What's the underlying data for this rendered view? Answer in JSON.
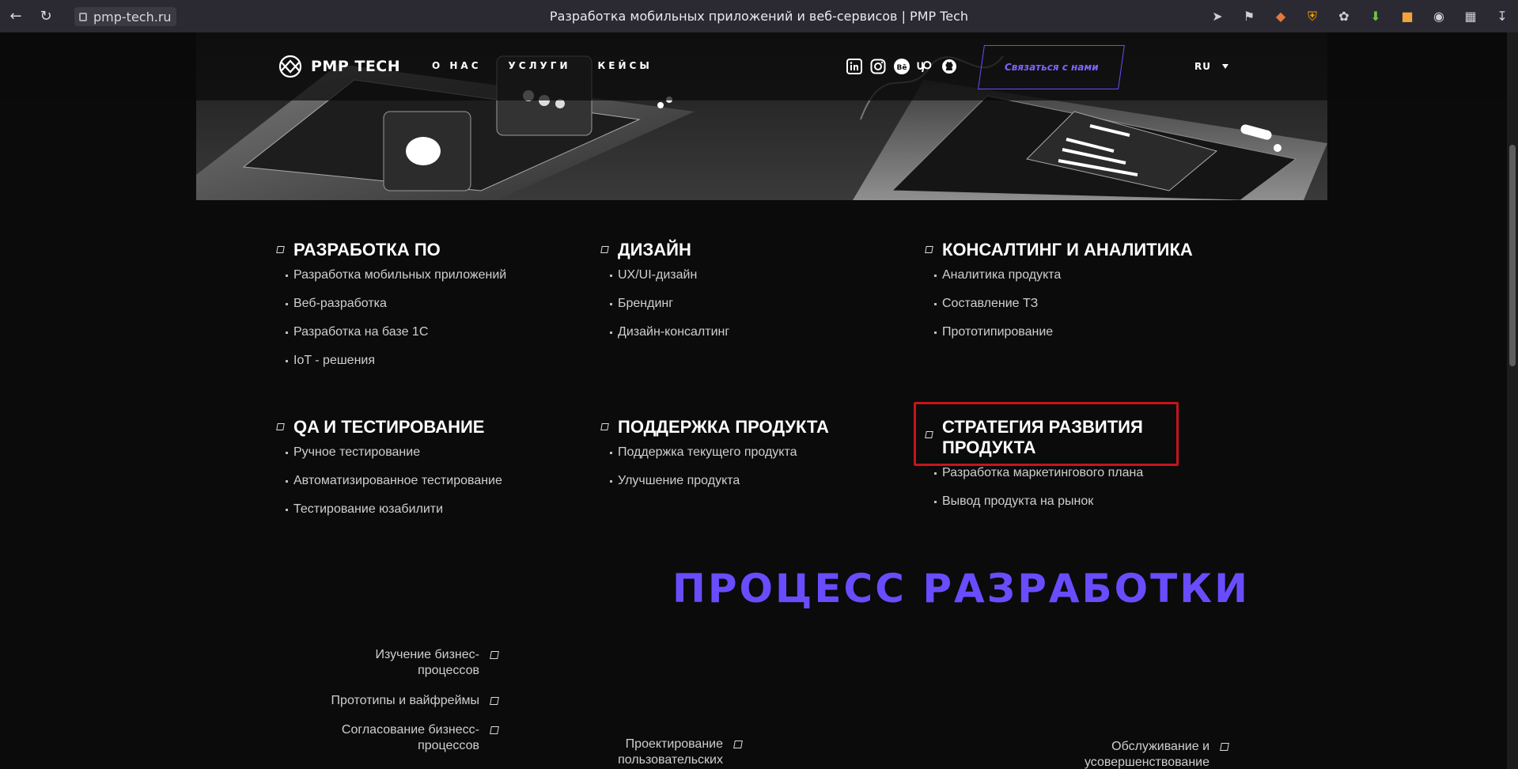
{
  "browser": {
    "url": "pmp-tech.ru",
    "tab_title": "Разработка мобильных приложений и веб-сервисов | PMP Tech"
  },
  "header": {
    "logo_text": "PMP TECH",
    "menu": [
      "О НАС",
      "УСЛУГИ",
      "КЕЙСЫ"
    ],
    "socials": [
      "linkedin-icon",
      "instagram-icon",
      "behance-icon",
      "upwork-icon",
      "github-icon"
    ],
    "contact_label": "Связаться с нами",
    "language": "RU",
    "accent_color": "#6a4cff"
  },
  "services": [
    {
      "title": "РАЗРАБОТКА ПО",
      "items": [
        "Разработка мобильных приложений",
        "Веб-разработка",
        "Разработка на базе 1С",
        "IoT - решения"
      ]
    },
    {
      "title": "ДИЗАЙН",
      "items": [
        "UX/UI-дизайн",
        "Брендинг",
        "Дизайн-консалтинг"
      ]
    },
    {
      "title": "КОНСАЛТИНГ И АНАЛИТИКА",
      "items": [
        "Аналитика продукта",
        "Составление ТЗ",
        "Прототипирование"
      ]
    },
    {
      "title": "QA И ТЕСТИРОВАНИЕ",
      "items": [
        "Ручное тестирование",
        "Автоматизированное тестирование",
        "Тестирование юзабилити"
      ]
    },
    {
      "title": "ПОДДЕРЖКА ПРОДУКТА",
      "items": [
        "Поддержка текущего продукта",
        "Улучшение продукта"
      ]
    },
    {
      "title_line1": "СТРАТЕГИЯ РАЗВИТИЯ",
      "title_line2": "ПРОДУКТА",
      "items": [
        "Разработка маркетингового плана",
        "Вывод продукта на рынок"
      ]
    }
  ],
  "process": {
    "title": "ПРОЦЕСС РАЗРАБОТКИ",
    "steps": [
      {
        "line1": "Изучение бизнес-",
        "line2": "процессов"
      },
      {
        "line1": "Прототипы и вайфреймы",
        "line2": ""
      },
      {
        "line1": "Согласование бизнесс-",
        "line2": "процессов"
      },
      {
        "line1": "Проектирование",
        "line2": "пользовательских"
      },
      {
        "line1": "Обслуживание и",
        "line2": "усовершенствование"
      }
    ]
  }
}
